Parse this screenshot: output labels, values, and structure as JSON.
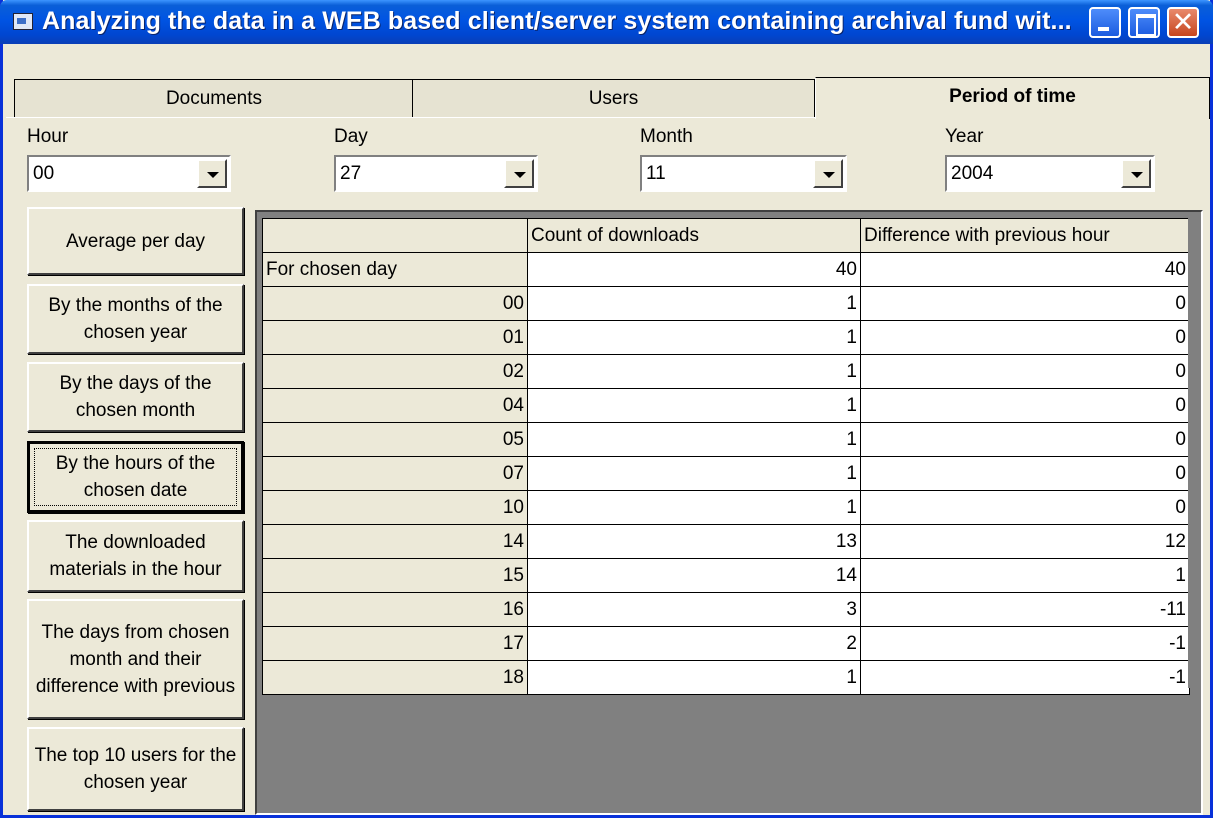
{
  "window": {
    "title": "Analyzing the data in a WEB based client/server system containing archival fund wit..."
  },
  "tabs": [
    {
      "label": "Documents"
    },
    {
      "label": "Users"
    },
    {
      "label": "Period of time"
    }
  ],
  "filters": {
    "hour": {
      "label": "Hour",
      "value": "00"
    },
    "day": {
      "label": "Day",
      "value": "27"
    },
    "month": {
      "label": "Month",
      "value": "11"
    },
    "year": {
      "label": "Year",
      "value": "2004"
    }
  },
  "buttons": [
    {
      "label": "Average per day"
    },
    {
      "label": "By the months of the chosen year"
    },
    {
      "label": "By the days of the chosen month"
    },
    {
      "label": "By the hours of the chosen date"
    },
    {
      "label": "The downloaded materials in the hour"
    },
    {
      "label": "The days from chosen month and their difference with previous"
    },
    {
      "label": "The top 10 users for the chosen year"
    }
  ],
  "table": {
    "columns": [
      "",
      "Count of downloads",
      "Difference with previous hour"
    ],
    "rows": [
      [
        "For chosen day",
        "40",
        "40"
      ],
      [
        "00",
        "1",
        "0"
      ],
      [
        "01",
        "1",
        "0"
      ],
      [
        "02",
        "1",
        "0"
      ],
      [
        "04",
        "1",
        "0"
      ],
      [
        "05",
        "1",
        "0"
      ],
      [
        "07",
        "1",
        "0"
      ],
      [
        "10",
        "1",
        "0"
      ],
      [
        "14",
        "13",
        "12"
      ],
      [
        "15",
        "14",
        "1"
      ],
      [
        "16",
        "3",
        "-11"
      ],
      [
        "17",
        "2",
        "-1"
      ],
      [
        "18",
        "1",
        "-1"
      ]
    ]
  },
  "icons": {
    "app": "app-icon",
    "minimize": "minimize-icon",
    "maximize": "maximize-icon",
    "close": "close-icon",
    "dropdown": "chevron-down-icon"
  },
  "colors": {
    "titlebar": "#0054e3",
    "face": "#ece9d8",
    "close": "#c6461f",
    "gridBg": "#808080"
  }
}
